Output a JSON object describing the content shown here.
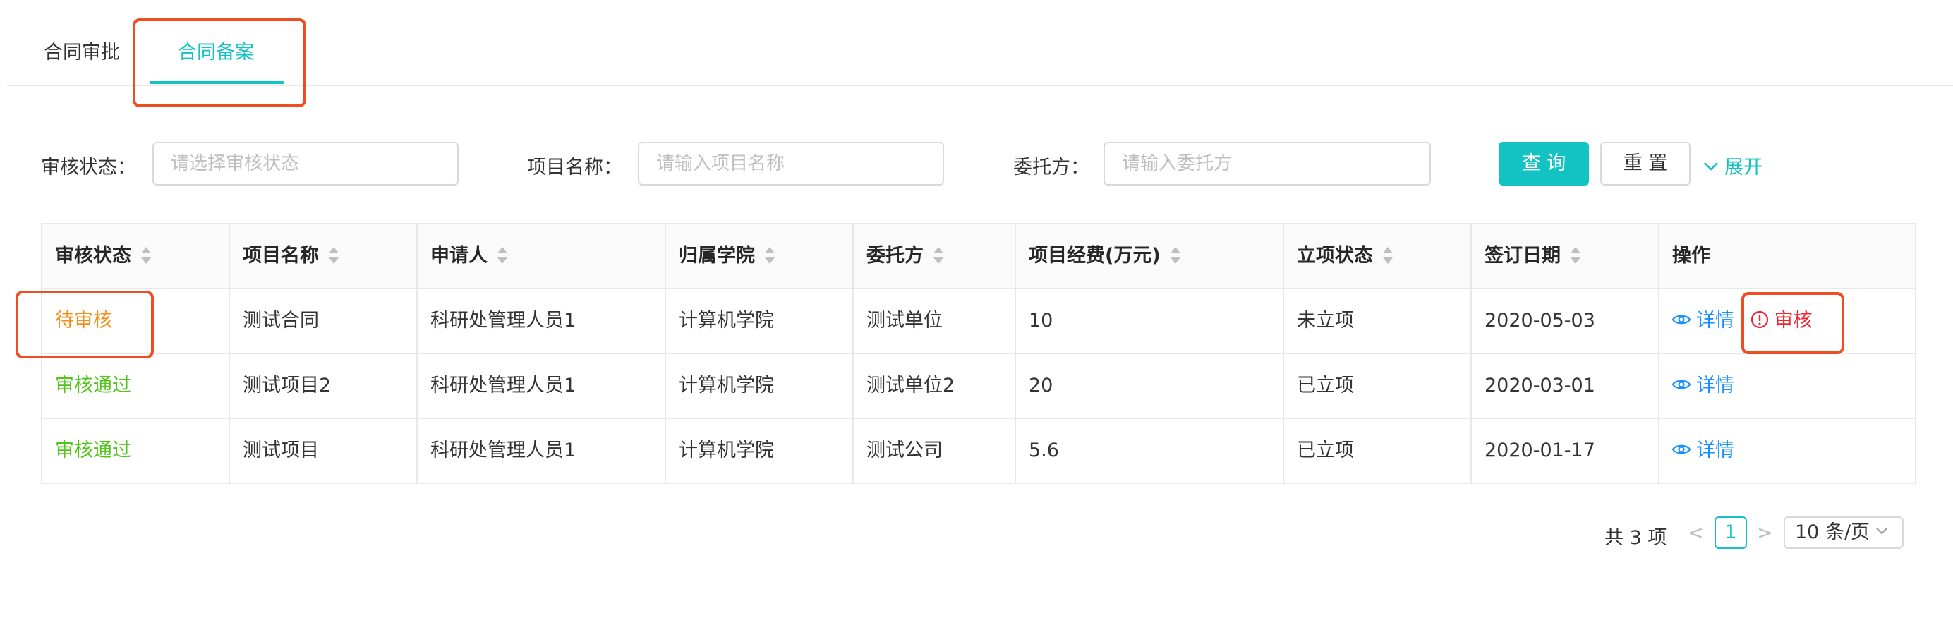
{
  "tabs": [
    {
      "label": "合同审批"
    },
    {
      "label": "合同备案"
    }
  ],
  "filters": {
    "status_label": "审核状态：",
    "status_placeholder": "请选择审核状态",
    "project_label": "项目名称：",
    "project_placeholder": "请输入项目名称",
    "client_label": "委托方：",
    "client_placeholder": "请输入委托方",
    "query_button": "查 询",
    "reset_button": "重 置",
    "expand_label": "展开"
  },
  "table": {
    "headers": [
      "审核状态",
      "项目名称",
      "申请人",
      "归属学院",
      "委托方",
      "项目经费(万元)",
      "立项状态",
      "签订日期",
      "操作"
    ],
    "rows": [
      {
        "status": "待审核",
        "project": "测试合同",
        "applicant": "科研处管理人员1",
        "college": "计算机学院",
        "client": "测试单位",
        "funds": "10",
        "setup": "未立项",
        "date": "2020-05-03",
        "detail": "详情",
        "audit": "审核"
      },
      {
        "status": "审核通过",
        "project": "测试项目2",
        "applicant": "科研处管理人员1",
        "college": "计算机学院",
        "client": "测试单位2",
        "funds": "20",
        "setup": "已立项",
        "date": "2020-03-01",
        "detail": "详情"
      },
      {
        "status": "审核通过",
        "project": "测试项目",
        "applicant": "科研处管理人员1",
        "college": "计算机学院",
        "client": "测试公司",
        "funds": "5.6",
        "setup": "已立项",
        "date": "2020-01-17",
        "detail": "详情"
      }
    ]
  },
  "pagination": {
    "total": "共 3 项",
    "current_page": "1",
    "page_size": "10 条/页"
  },
  "colors": {
    "accent": "#13c2c2",
    "highlight_box": "#f04d22",
    "pending": "#fa8c16",
    "passed": "#52c41a",
    "link": "#1890ff",
    "danger": "#f5222d"
  },
  "icons": [
    "eye-icon",
    "exclamation-circle-icon",
    "chevron-down-icon",
    "sort-icon",
    "chevron-left-icon",
    "chevron-right-icon"
  ]
}
